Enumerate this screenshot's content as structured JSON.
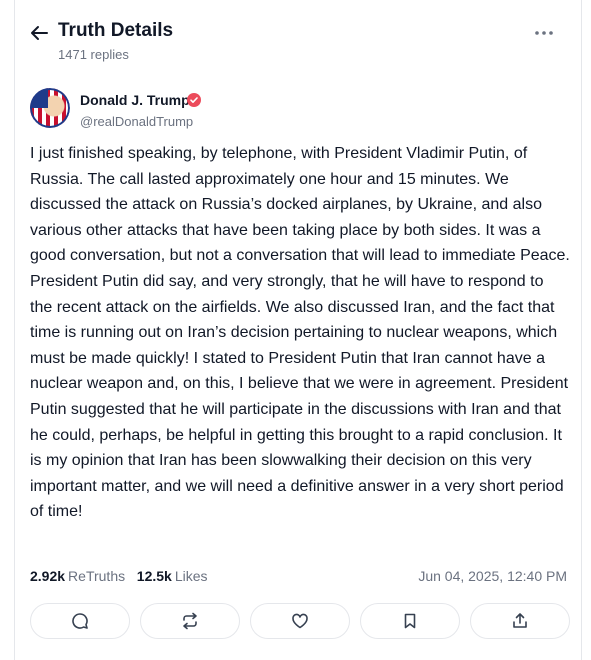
{
  "header": {
    "title": "Truth Details",
    "replies": "1471 replies"
  },
  "post": {
    "author_name": "Donald J. Trump",
    "author_handle": "@realDonaldTrump",
    "verified_color": "#ec4b5b",
    "text": "I just finished speaking, by telephone, with President Vladimir Putin, of Russia. The call lasted approximately one hour and 15 minutes. We discussed the attack on Russia’s docked airplanes, by Ukraine, and also various other attacks that have been taking place by both sides. It was a good conversation, but not a conversation that will lead to immediate Peace. President Putin did say, and very strongly, that he will have to respond to the recent attack on the airfields. We also discussed Iran, and the fact that time is running out on Iran’s decision pertaining to nuclear weapons, which must be made quickly! I stated to President Putin that Iran cannot have a nuclear weapon and, on this, I believe that we were in agreement. President Putin suggested that he will participate in the discussions with Iran and that he could, perhaps, be helpful in getting this brought to a rapid conclusion. It is my opinion that Iran has been slowwalking their decision on this very important matter, and we will need a definitive answer in a very short period of time!",
    "retruths_count": "2.92k",
    "retruths_label": "ReTruths",
    "likes_count": "12.5k",
    "likes_label": "Likes",
    "timestamp": "Jun 04, 2025, 12:40 PM"
  },
  "actions": [
    {
      "icon": "reply-icon"
    },
    {
      "icon": "retruth-icon"
    },
    {
      "icon": "like-heart-icon"
    },
    {
      "icon": "bookmark-icon"
    },
    {
      "icon": "share-icon"
    }
  ]
}
